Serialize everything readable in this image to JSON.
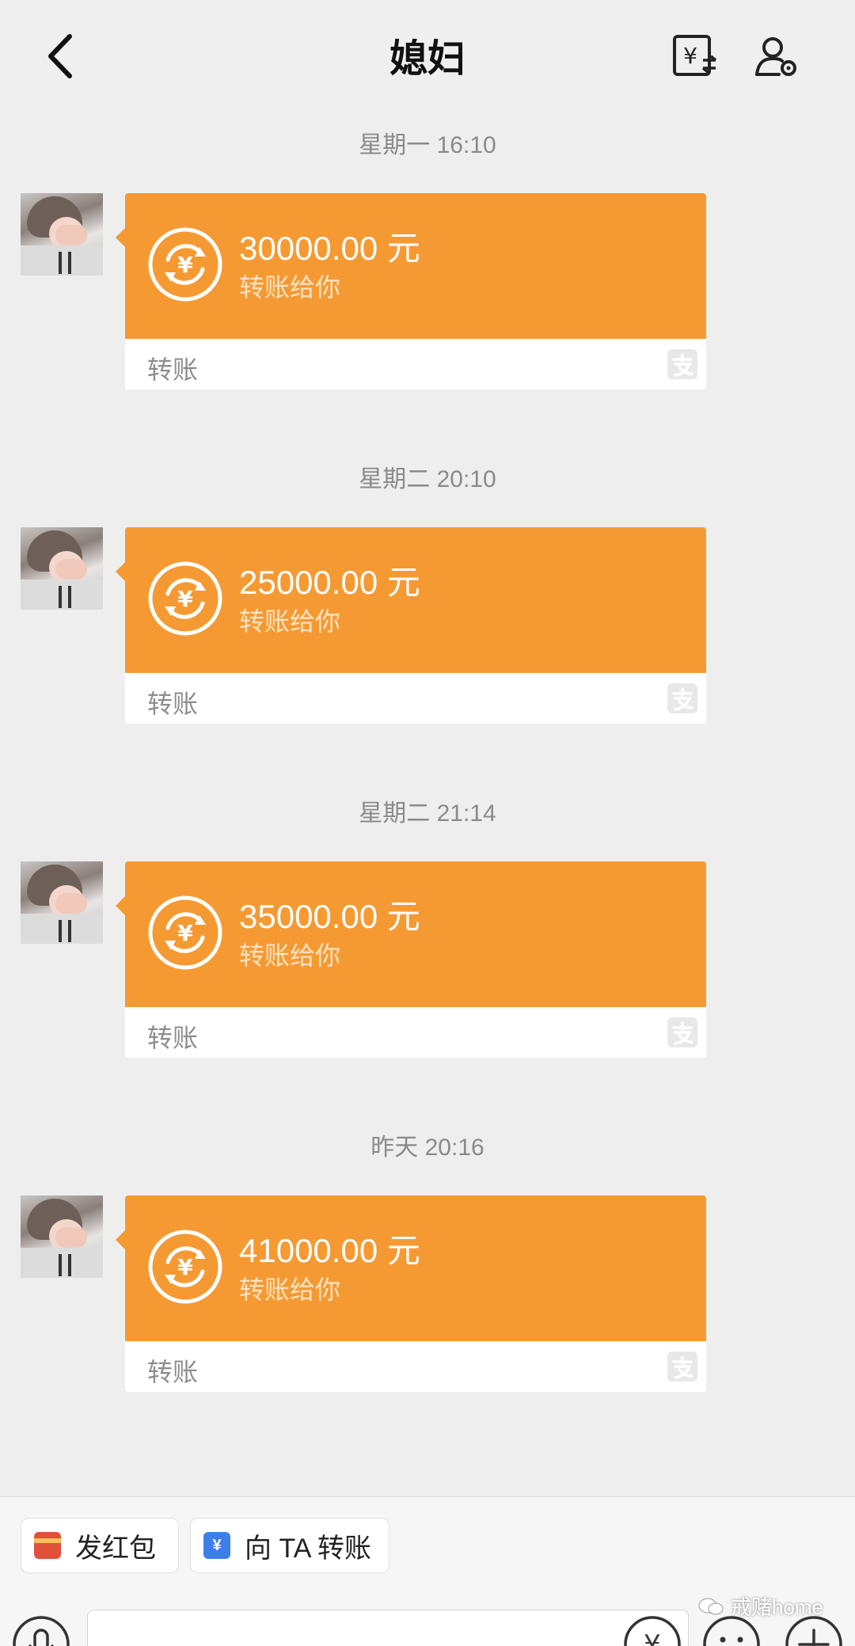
{
  "header": {
    "title": "媳妇",
    "back_icon": "chevron-left-icon",
    "transfer_icon": "yuan-transfer-icon",
    "settings_icon": "user-settings-icon"
  },
  "messages": [
    {
      "timestamp": "星期一 16:10",
      "amount": "30000.00 元",
      "subtitle": "转账给你",
      "footer": "转账"
    },
    {
      "timestamp": "星期二 20:10",
      "amount": "25000.00 元",
      "subtitle": "转账给你",
      "footer": "转账"
    },
    {
      "timestamp": "星期二 21:14",
      "amount": "35000.00 元",
      "subtitle": "转账给你",
      "footer": "转账"
    },
    {
      "timestamp": "昨天 20:16",
      "amount": "41000.00 元",
      "subtitle": "转账给你",
      "footer": "转账"
    }
  ],
  "toolbar": {
    "red_packet_label": "发红包",
    "transfer_label": "向 TA 转账",
    "transfer_icon_glyph": "¥"
  },
  "watermark": {
    "text": "戒赌home"
  },
  "colors": {
    "card_orange": "#f59a33",
    "background": "#eeeeee",
    "timestamp_text": "#8a8a8a"
  }
}
